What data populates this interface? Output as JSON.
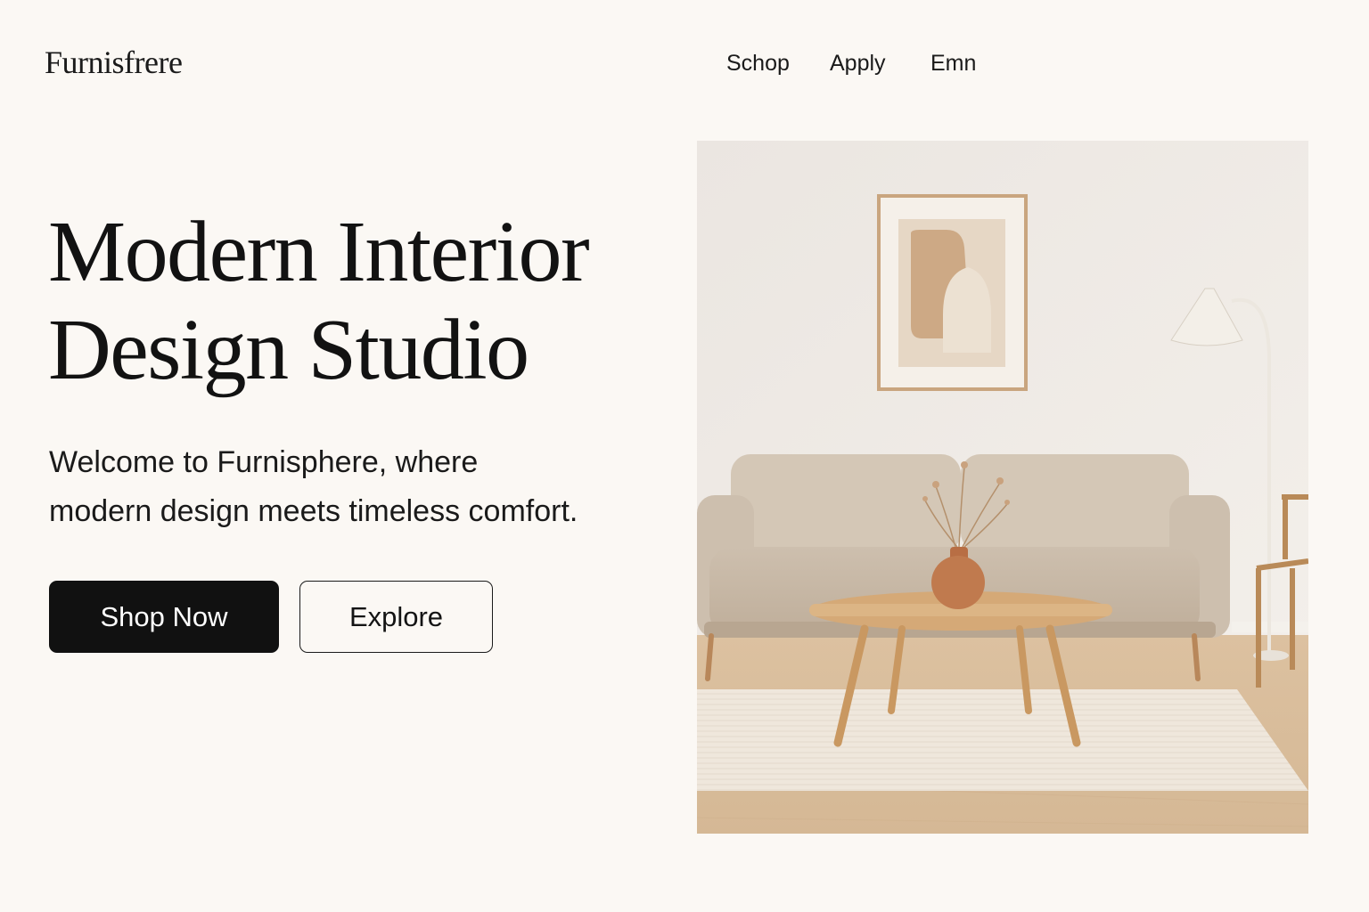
{
  "header": {
    "brand": "Furnisfrere",
    "nav": [
      "Schop",
      "Apply",
      "Emn"
    ]
  },
  "hero": {
    "title_lines": [
      "Modern Interior",
      "Design Studio"
    ],
    "subtitle_lines": [
      "Welcome to Furnisphere, where",
      "modern design meets timeless comfort."
    ],
    "primary_button": "Shop Now",
    "secondary_button": "Explore"
  },
  "colors": {
    "background": "#fbf8f4",
    "primary_button_bg": "#111111",
    "primary_button_text": "#ffffff",
    "text": "#121212"
  }
}
